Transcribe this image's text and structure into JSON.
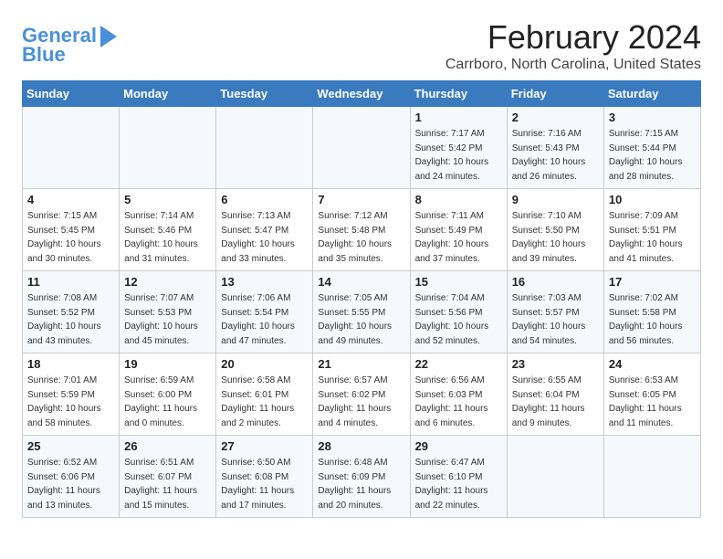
{
  "logo": {
    "line1": "General",
    "line2": "Blue"
  },
  "title": "February 2024",
  "subtitle": "Carrboro, North Carolina, United States",
  "days_of_week": [
    "Sunday",
    "Monday",
    "Tuesday",
    "Wednesday",
    "Thursday",
    "Friday",
    "Saturday"
  ],
  "weeks": [
    [
      {
        "day": "",
        "info": ""
      },
      {
        "day": "",
        "info": ""
      },
      {
        "day": "",
        "info": ""
      },
      {
        "day": "",
        "info": ""
      },
      {
        "day": "1",
        "info": "Sunrise: 7:17 AM\nSunset: 5:42 PM\nDaylight: 10 hours\nand 24 minutes."
      },
      {
        "day": "2",
        "info": "Sunrise: 7:16 AM\nSunset: 5:43 PM\nDaylight: 10 hours\nand 26 minutes."
      },
      {
        "day": "3",
        "info": "Sunrise: 7:15 AM\nSunset: 5:44 PM\nDaylight: 10 hours\nand 28 minutes."
      }
    ],
    [
      {
        "day": "4",
        "info": "Sunrise: 7:15 AM\nSunset: 5:45 PM\nDaylight: 10 hours\nand 30 minutes."
      },
      {
        "day": "5",
        "info": "Sunrise: 7:14 AM\nSunset: 5:46 PM\nDaylight: 10 hours\nand 31 minutes."
      },
      {
        "day": "6",
        "info": "Sunrise: 7:13 AM\nSunset: 5:47 PM\nDaylight: 10 hours\nand 33 minutes."
      },
      {
        "day": "7",
        "info": "Sunrise: 7:12 AM\nSunset: 5:48 PM\nDaylight: 10 hours\nand 35 minutes."
      },
      {
        "day": "8",
        "info": "Sunrise: 7:11 AM\nSunset: 5:49 PM\nDaylight: 10 hours\nand 37 minutes."
      },
      {
        "day": "9",
        "info": "Sunrise: 7:10 AM\nSunset: 5:50 PM\nDaylight: 10 hours\nand 39 minutes."
      },
      {
        "day": "10",
        "info": "Sunrise: 7:09 AM\nSunset: 5:51 PM\nDaylight: 10 hours\nand 41 minutes."
      }
    ],
    [
      {
        "day": "11",
        "info": "Sunrise: 7:08 AM\nSunset: 5:52 PM\nDaylight: 10 hours\nand 43 minutes."
      },
      {
        "day": "12",
        "info": "Sunrise: 7:07 AM\nSunset: 5:53 PM\nDaylight: 10 hours\nand 45 minutes."
      },
      {
        "day": "13",
        "info": "Sunrise: 7:06 AM\nSunset: 5:54 PM\nDaylight: 10 hours\nand 47 minutes."
      },
      {
        "day": "14",
        "info": "Sunrise: 7:05 AM\nSunset: 5:55 PM\nDaylight: 10 hours\nand 49 minutes."
      },
      {
        "day": "15",
        "info": "Sunrise: 7:04 AM\nSunset: 5:56 PM\nDaylight: 10 hours\nand 52 minutes."
      },
      {
        "day": "16",
        "info": "Sunrise: 7:03 AM\nSunset: 5:57 PM\nDaylight: 10 hours\nand 54 minutes."
      },
      {
        "day": "17",
        "info": "Sunrise: 7:02 AM\nSunset: 5:58 PM\nDaylight: 10 hours\nand 56 minutes."
      }
    ],
    [
      {
        "day": "18",
        "info": "Sunrise: 7:01 AM\nSunset: 5:59 PM\nDaylight: 10 hours\nand 58 minutes."
      },
      {
        "day": "19",
        "info": "Sunrise: 6:59 AM\nSunset: 6:00 PM\nDaylight: 11 hours\nand 0 minutes."
      },
      {
        "day": "20",
        "info": "Sunrise: 6:58 AM\nSunset: 6:01 PM\nDaylight: 11 hours\nand 2 minutes."
      },
      {
        "day": "21",
        "info": "Sunrise: 6:57 AM\nSunset: 6:02 PM\nDaylight: 11 hours\nand 4 minutes."
      },
      {
        "day": "22",
        "info": "Sunrise: 6:56 AM\nSunset: 6:03 PM\nDaylight: 11 hours\nand 6 minutes."
      },
      {
        "day": "23",
        "info": "Sunrise: 6:55 AM\nSunset: 6:04 PM\nDaylight: 11 hours\nand 9 minutes."
      },
      {
        "day": "24",
        "info": "Sunrise: 6:53 AM\nSunset: 6:05 PM\nDaylight: 11 hours\nand 11 minutes."
      }
    ],
    [
      {
        "day": "25",
        "info": "Sunrise: 6:52 AM\nSunset: 6:06 PM\nDaylight: 11 hours\nand 13 minutes."
      },
      {
        "day": "26",
        "info": "Sunrise: 6:51 AM\nSunset: 6:07 PM\nDaylight: 11 hours\nand 15 minutes."
      },
      {
        "day": "27",
        "info": "Sunrise: 6:50 AM\nSunset: 6:08 PM\nDaylight: 11 hours\nand 17 minutes."
      },
      {
        "day": "28",
        "info": "Sunrise: 6:48 AM\nSunset: 6:09 PM\nDaylight: 11 hours\nand 20 minutes."
      },
      {
        "day": "29",
        "info": "Sunrise: 6:47 AM\nSunset: 6:10 PM\nDaylight: 11 hours\nand 22 minutes."
      },
      {
        "day": "",
        "info": ""
      },
      {
        "day": "",
        "info": ""
      }
    ]
  ]
}
